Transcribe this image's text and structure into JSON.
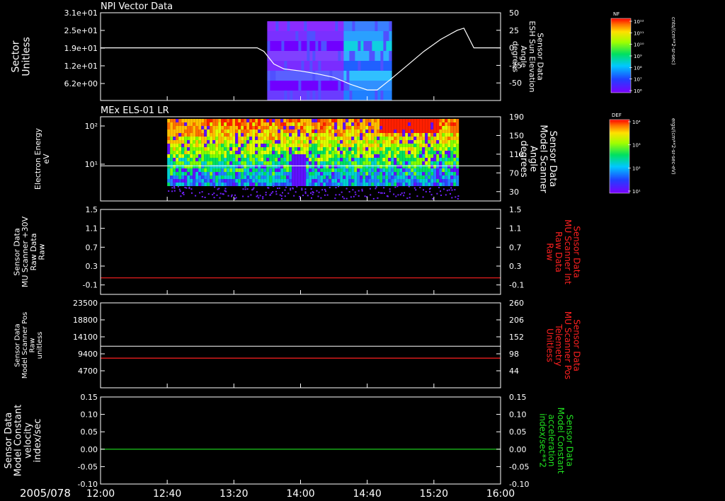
{
  "colors": {
    "background": "#000000",
    "axis": "#ffffff",
    "red_trace": "#ff2020",
    "green_trace": "#20e020",
    "white_trace": "#ffffff"
  },
  "footer": {
    "date": "2005/078",
    "time_ticks": [
      "12:00",
      "12:40",
      "13:20",
      "14:00",
      "14:40",
      "15:20",
      "16:00"
    ]
  },
  "chart_data": [
    {
      "type": "heatmap",
      "title": "NPI Vector Data",
      "ylabel_lines": [
        "Sector",
        "Unitless"
      ],
      "y_ticks": [
        "3.1e+01",
        "2.5e+01",
        "1.9e+01",
        "1.2e+01",
        "6.2e+00"
      ],
      "right_ylabel_lines": [
        "Sensor Data",
        "ESH Sun Elevation",
        "Angle",
        "degrees"
      ],
      "right_ticks": [
        "50",
        "25",
        "0",
        "-25",
        "-50"
      ],
      "right_ylim": [
        -75,
        50
      ],
      "xlim": [
        "12:00",
        "16:00"
      ],
      "data_span": [
        "13:40",
        "14:54"
      ],
      "overlay_line": {
        "x": [
          "12:00",
          "13:34",
          "13:38",
          "13:44",
          "13:50",
          "14:00",
          "14:10",
          "14:20",
          "14:30",
          "14:40",
          "14:46",
          "14:54",
          "15:04",
          "15:14",
          "15:24",
          "15:34",
          "15:38",
          "15:44",
          "16:00"
        ],
        "y": [
          0,
          0,
          -5,
          -23,
          -30,
          -33,
          -37,
          -42,
          -52,
          -60,
          -60,
          -45,
          -25,
          -5,
          12,
          25,
          28,
          0,
          0
        ]
      },
      "colorbar": {
        "label": "NF",
        "units": "cnts/(cm**2-sr-sec)",
        "ticks": [
          "10¹²",
          "10¹¹",
          "10¹⁰",
          "10⁹",
          "10⁸",
          "10⁷",
          "10⁶"
        ]
      }
    },
    {
      "type": "heatmap",
      "title": "MEx ELS-01 LR",
      "ylabel_lines": [
        "Electron Energy",
        "eV"
      ],
      "y_ticks": [
        "10²",
        "10¹"
      ],
      "right_ylabel_lines": [
        "Sensor Data",
        "Model Scanner",
        "Angle",
        "degrees"
      ],
      "right_ticks": [
        "190",
        "150",
        "110",
        "70",
        "30"
      ],
      "right_ylim": [
        10,
        190
      ],
      "data_span": [
        "12:40",
        "15:34"
      ],
      "overlay_line": {
        "x": [
          "12:00",
          "16:00"
        ],
        "y": [
          85,
          85
        ]
      },
      "colorbar": {
        "label": "DEF",
        "units": "ergs/(cm**2-sr-sec-eV)",
        "ticks": [
          "10⁴",
          "10³",
          "10²",
          "10¹"
        ]
      }
    },
    {
      "type": "line",
      "ylabel_lines": [
        "Sensor Data",
        "MU Scanner +30V",
        "Raw Data",
        "Raw"
      ],
      "y_ticks": [
        "1.5",
        "1.1",
        "0.7",
        "0.3",
        "-0.1"
      ],
      "ylim": [
        -0.3,
        1.5
      ],
      "right_ylabel_lines": [
        "Sensor Data",
        "MU Scanner Int",
        "Raw Data",
        "Raw"
      ],
      "right_ticks": [
        "1.5",
        "1.1",
        "0.7",
        "0.3",
        "-0.1"
      ],
      "series": [
        {
          "x": [
            "12:00",
            "16:00"
          ],
          "values": [
            0.05,
            0.05
          ]
        }
      ]
    },
    {
      "type": "line",
      "ylabel_lines": [
        "Sensor Data",
        "Model Scanner Pos",
        "Raw",
        "unitless"
      ],
      "y_ticks": [
        "23500",
        "18800",
        "14100",
        "9400",
        "4700"
      ],
      "ylim": [
        0,
        23500
      ],
      "right_ylabel_lines": [
        "Sensor Data",
        "MU Scanner Pos",
        "Telemetry",
        "Unitless"
      ],
      "right_ticks": [
        "260",
        "206",
        "152",
        "98",
        "44"
      ],
      "right_ylim": [
        -10,
        260
      ],
      "series": [
        {
          "x": [
            "12:00",
            "16:00"
          ],
          "values": [
            11500,
            11500
          ]
        },
        {
          "x": [
            "12:00",
            "16:00"
          ],
          "values": [
            8200,
            8200
          ],
          "axis": "right"
        }
      ]
    },
    {
      "type": "line",
      "ylabel_lines": [
        "Sensor Data",
        "Model Constant",
        "velocity",
        "index/sec"
      ],
      "y_ticks": [
        "0.15",
        "0.10",
        "0.05",
        "0.00",
        "-0.05",
        "-0.10"
      ],
      "ylim": [
        -0.1,
        0.15
      ],
      "right_ylabel_lines": [
        "Sensor Data",
        "Model Constant",
        "acceleration",
        "index/sec**2"
      ],
      "right_ticks": [
        "0.15",
        "0.10",
        "0.05",
        "0.00",
        "-0.05",
        "-0.10"
      ],
      "series": [
        {
          "x": [
            "12:00",
            "16:00"
          ],
          "values": [
            0.0,
            0.0
          ]
        }
      ]
    }
  ]
}
